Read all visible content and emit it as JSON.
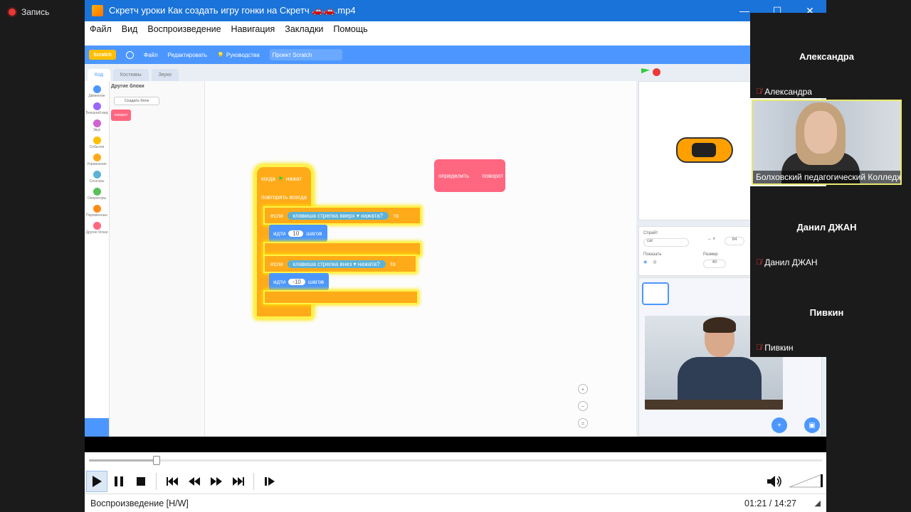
{
  "recording": {
    "label": "Запись"
  },
  "player": {
    "title": "Скретч уроки Как создать игру гонки на Скретч 🚗🚗.mp4",
    "menu": [
      "Файл",
      "Вид",
      "Воспроизведение",
      "Навигация",
      "Закладки",
      "Помощь"
    ],
    "progress": 0.092,
    "status_left": "Воспроизведение [H/W]",
    "time": "01:21 / 14:27"
  },
  "scratch": {
    "top_menu": {
      "file": "Файл",
      "edit": "Редактировать",
      "tutorials": "Руководства",
      "project": "Проект Scratch"
    },
    "tabs": [
      "Код",
      "Костюмы",
      "Звуки"
    ],
    "categories": [
      {
        "label": "Движение",
        "color": "#4c97ff"
      },
      {
        "label": "Внешний вид",
        "color": "#9966ff"
      },
      {
        "label": "Звук",
        "color": "#cf63cf"
      },
      {
        "label": "События",
        "color": "#ffbf00"
      },
      {
        "label": "Управление",
        "color": "#ffab19"
      },
      {
        "label": "Сенсоры",
        "color": "#5cb1d6"
      },
      {
        "label": "Операторы",
        "color": "#59c059"
      },
      {
        "label": "Переменные",
        "color": "#ff8c1a"
      },
      {
        "label": "Другие блоки",
        "color": "#ff6680"
      }
    ],
    "palette_header": "Другие блоки",
    "make_block": "Создать блок",
    "palette_block": "поворот",
    "hat": {
      "when": "когда",
      "clicked": "нажат"
    },
    "forever": "повторять всегда",
    "if1": {
      "if": "если",
      "key": "клавиша",
      "which": "стрелка вверх ▾",
      "pressed": "нажата?",
      "then": "то"
    },
    "move1": {
      "label": "идти",
      "value": "10",
      "unit": "шагов"
    },
    "if2": {
      "if": "если",
      "key": "клавиша",
      "which": "стрелка вниз ▾",
      "pressed": "нажата?",
      "then": "то"
    },
    "move2": {
      "label": "идти",
      "value": "-10",
      "unit": "шагов"
    },
    "define": {
      "label": "определить",
      "name": "поворот"
    },
    "sprite_info": {
      "sprite": "Спрайт",
      "name": "car",
      "show": "Показать",
      "size": "Размер",
      "x": "64",
      "size_val": "40"
    }
  },
  "participants": [
    {
      "name": "Александра",
      "label": "Александра"
    },
    {
      "caption": "Болховский педагогический Колледж"
    },
    {
      "name": "Данил ДЖАН",
      "label": "Данил ДЖАН"
    },
    {
      "name": "Пивкин",
      "label": "Пивкин"
    }
  ]
}
